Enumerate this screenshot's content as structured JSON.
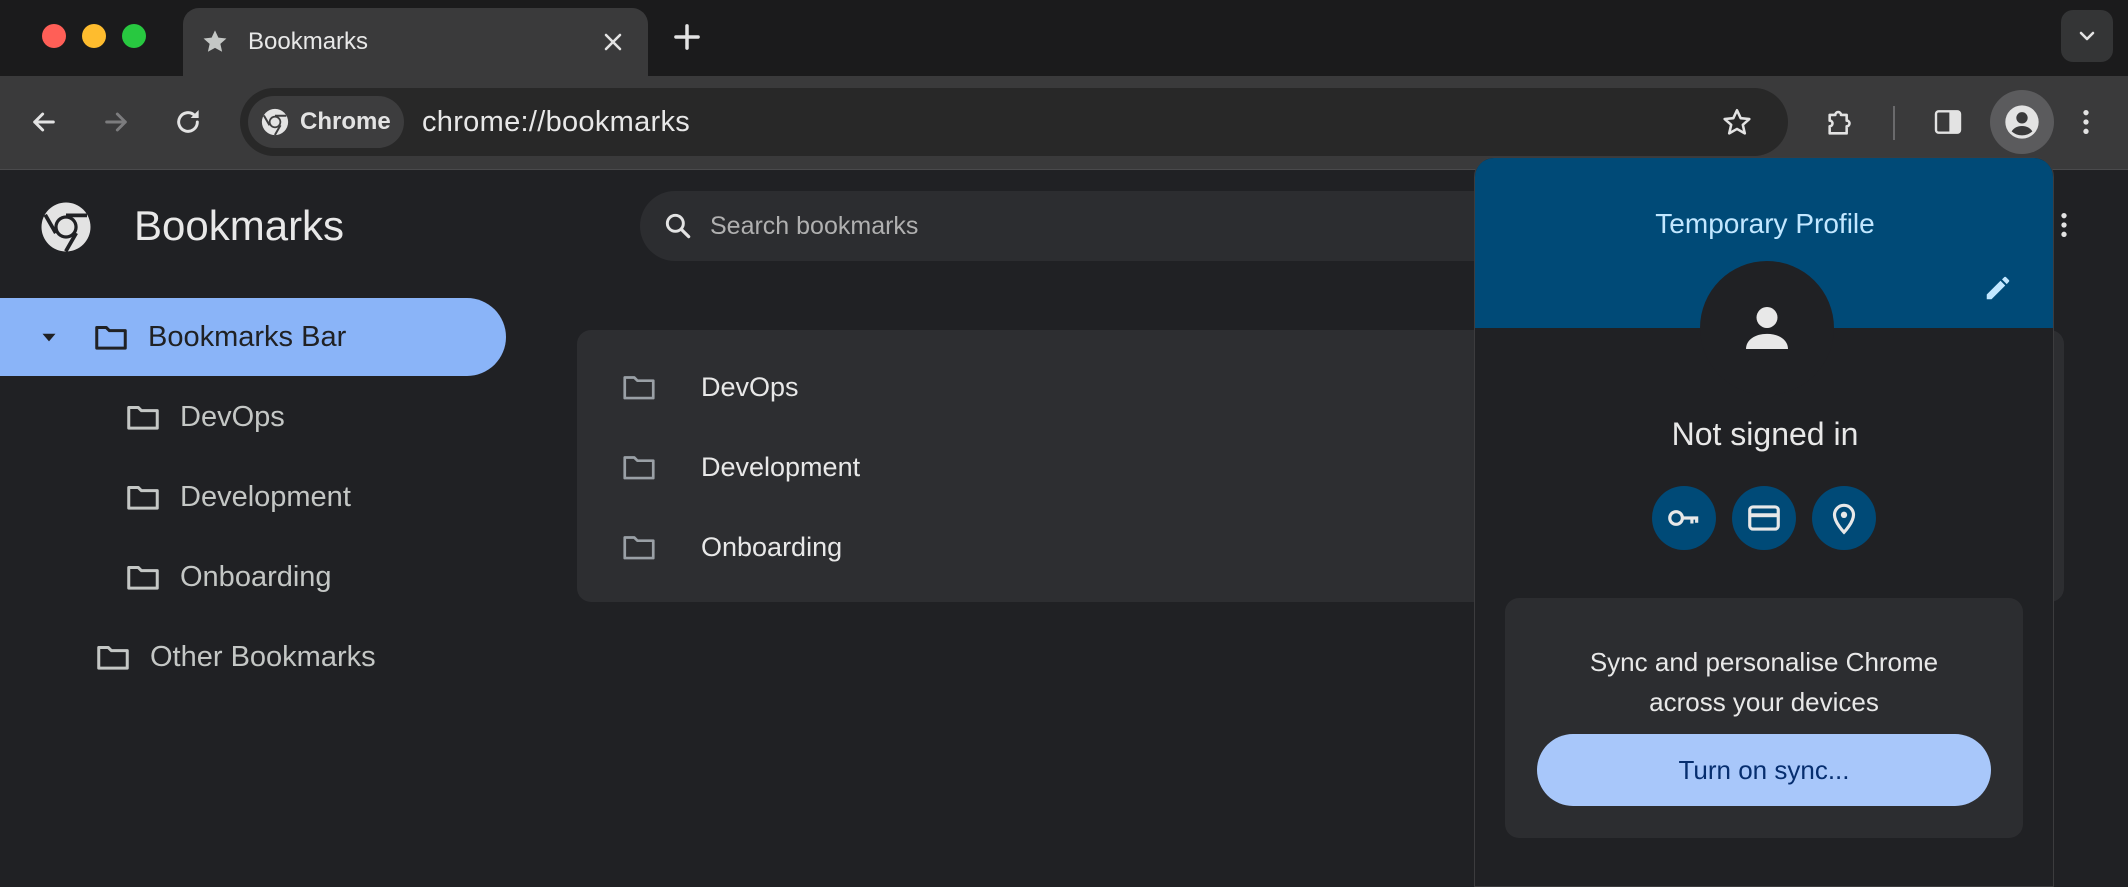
{
  "tab": {
    "title": "Bookmarks"
  },
  "toolbar": {
    "chip_label": "Chrome",
    "url": "chrome://bookmarks"
  },
  "page": {
    "title": "Bookmarks",
    "search_placeholder": "Search bookmarks"
  },
  "sidebar": {
    "bookmarks_bar": "Bookmarks Bar",
    "children": [
      "DevOps",
      "Development",
      "Onboarding"
    ],
    "other": "Other Bookmarks"
  },
  "list": {
    "items": [
      "DevOps",
      "Development",
      "Onboarding"
    ]
  },
  "profile_popup": {
    "title": "Temporary Profile",
    "status": "Not signed in",
    "sync_line1": "Sync and personalise Chrome",
    "sync_line2": "across your devices",
    "sync_button": "Turn on sync..."
  },
  "colors": {
    "accent": "#8ab4f8",
    "popup_header": "#004a77",
    "sync_button": "#a8c7fa"
  },
  "icons": {
    "tab": "star-icon",
    "traffic_lights": [
      "close",
      "minimize",
      "zoom"
    ],
    "popup_actions": [
      "key-icon",
      "credit-card-icon",
      "location-pin-icon"
    ]
  }
}
